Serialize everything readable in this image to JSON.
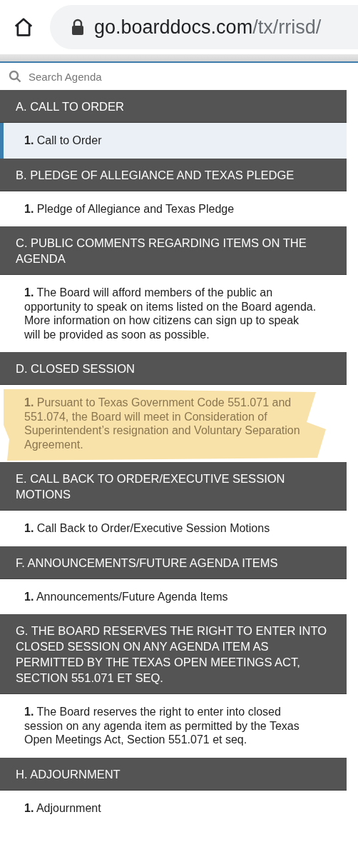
{
  "browser": {
    "url_host": "go.boarddocs.com",
    "url_path": "/tx/rrisd/"
  },
  "search": {
    "placeholder": "Search Agenda"
  },
  "sections": [
    {
      "header": "A. CALL TO ORDER",
      "items": [
        {
          "number": "1.",
          "text": "Call to Order",
          "selected": true,
          "highlighted": false
        }
      ]
    },
    {
      "header": "B. PLEDGE OF ALLEGIANCE AND TEXAS PLEDGE",
      "items": [
        {
          "number": "1.",
          "text": "Pledge of Allegiance and Texas Pledge",
          "selected": false,
          "highlighted": false
        }
      ]
    },
    {
      "header": "C. PUBLIC COMMENTS REGARDING ITEMS ON THE AGENDA",
      "items": [
        {
          "number": "1.",
          "text": "The Board will afford members of the public an opportunity to speak on items listed on the Board agenda. More information on how citizens can sign up to speak will be provided as soon as possible.",
          "selected": false,
          "highlighted": false
        }
      ]
    },
    {
      "header": "D. CLOSED SESSION",
      "items": [
        {
          "number": "1.",
          "text": "Pursuant to Texas Government Code 551.071 and 551.074, the Board will meet in Consideration of Superintendent’s resignation and Voluntary Separation Agreement.",
          "selected": false,
          "highlighted": true
        }
      ]
    },
    {
      "header": "E. CALL BACK TO ORDER/EXECUTIVE SESSION MOTIONS",
      "items": [
        {
          "number": "1.",
          "text": "Call Back to Order/Executive Session Motions",
          "selected": false,
          "highlighted": false
        }
      ]
    },
    {
      "header": "F. ANNOUNCEMENTS/FUTURE AGENDA ITEMS",
      "items": [
        {
          "number": "1.",
          "text": "Announcements/Future Agenda Items",
          "selected": false,
          "highlighted": false
        }
      ]
    },
    {
      "header": "G. THE BOARD RESERVES THE RIGHT TO ENTER INTO CLOSED SESSION ON ANY AGENDA ITEM AS PERMITTED BY THE TEXAS OPEN MEETINGS ACT, SECTION 551.071 ET SEQ.",
      "items": [
        {
          "number": "1.",
          "text": "The Board reserves the right to enter into closed session on any agenda item as permitted by the Texas Open Meetings Act, Section 551.071 et seq.",
          "selected": false,
          "highlighted": false
        }
      ]
    },
    {
      "header": "H. ADJOURNMENT",
      "items": [
        {
          "number": "1.",
          "text": "Adjournment",
          "selected": false,
          "highlighted": false
        }
      ]
    }
  ]
}
